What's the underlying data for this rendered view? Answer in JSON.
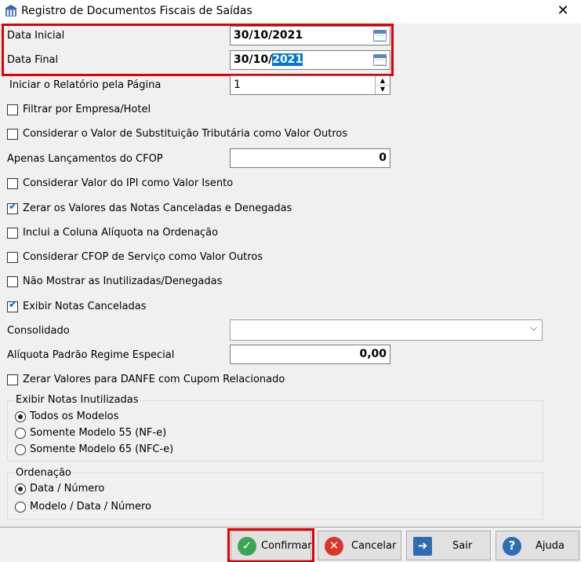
{
  "window": {
    "title": "Registro de Documentos Fiscais de Saídas",
    "close_symbol": "✕"
  },
  "data_inicial": {
    "label": "Data Inicial",
    "value": "30/10/2021"
  },
  "data_final": {
    "label": "Data Final",
    "value_prefix": "30/10/",
    "value_selected": "2021"
  },
  "pagina": {
    "label": "Iniciar o Relatório pela Página",
    "value": "1"
  },
  "checkboxes": {
    "filtrar_empresa": {
      "label": "Filtrar por Empresa/Hotel",
      "checked": false
    },
    "valor_subst": {
      "label": "Considerar o Valor de Substituição Tributária como Valor Outros",
      "checked": false
    },
    "ipi_isento": {
      "label": "Considerar Valor do IPI como Valor Isento",
      "checked": false
    },
    "zerar_canceladas": {
      "label": "Zerar os Valores das Notas Canceladas e Denegadas",
      "checked": true
    },
    "coluna_aliquota": {
      "label": "Inclui a Coluna Alíquota na Ordenação",
      "checked": false
    },
    "cfop_servico": {
      "label": "Considerar CFOP de Serviço como Valor Outros",
      "checked": false
    },
    "nao_mostrar_inutilizadas": {
      "label": "Não Mostrar as Inutilizadas/Denegadas",
      "checked": false
    },
    "exibir_canceladas": {
      "label": "Exibir Notas Canceladas",
      "checked": true
    },
    "zerar_danfe": {
      "label": "Zerar Valores para DANFE com Cupom Relacionado",
      "checked": false
    }
  },
  "cfop": {
    "label": "Apenas Lançamentos do CFOP",
    "value": "0"
  },
  "consolidado": {
    "label": "Consolidado",
    "value": ""
  },
  "aliquota_padrao": {
    "label": "Alíquota Padrão Regime Especial",
    "value": "0,00"
  },
  "group_inutilizadas": {
    "title": "Exibir Notas Inutilizadas",
    "options": [
      "Todos os Modelos",
      "Somente Modelo 55 (NF-e)",
      "Somente Modelo 65 (NFC-e)"
    ],
    "selected": "Todos os Modelos"
  },
  "group_ordenacao": {
    "title": "Ordenação",
    "options": [
      "Data / Número",
      "Modelo / Data / Número"
    ],
    "selected": "Data / Número"
  },
  "buttons": {
    "confirmar": "Confirmar",
    "cancelar": "Cancelar",
    "sair": "Sair",
    "ajuda": "Ajuda"
  },
  "colors": {
    "highlight_border": "#e10000",
    "selection": "#0078d7",
    "checkmark": "#0060c0"
  },
  "icons": {
    "confirmar": "check-circle-icon",
    "cancelar": "x-circle-icon",
    "sair": "exit-door-icon",
    "ajuda": "question-circle-icon"
  }
}
